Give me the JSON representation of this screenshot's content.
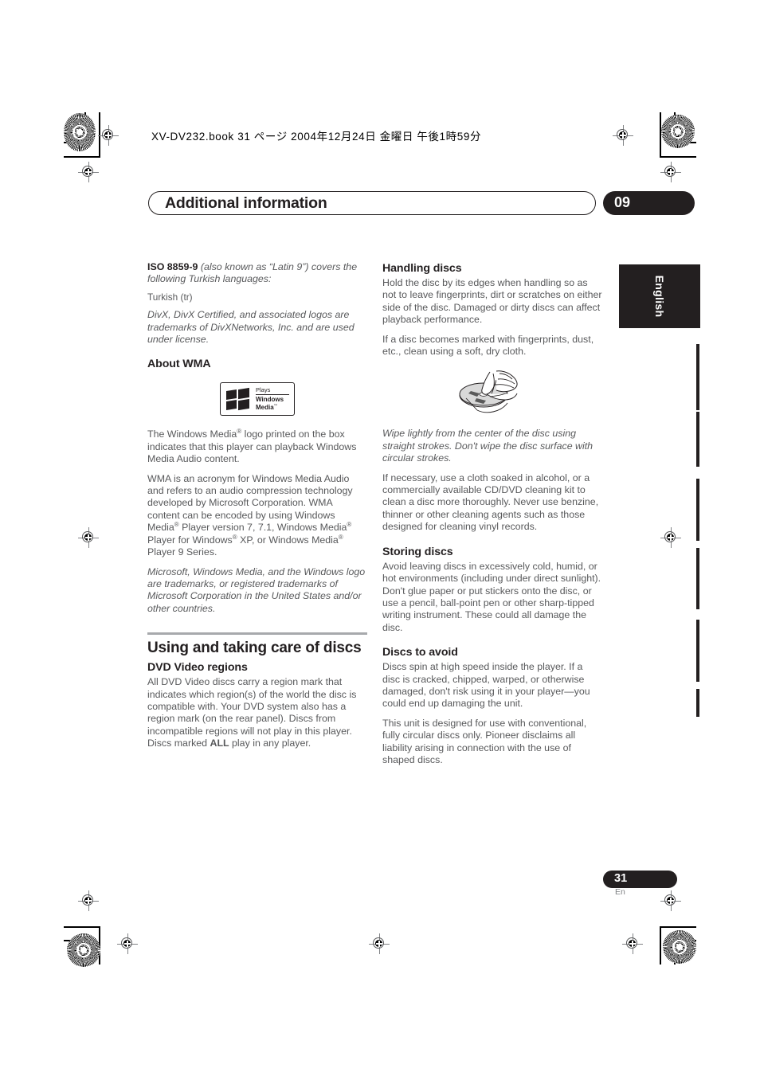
{
  "print_header": {
    "book_line": "XV-DV232.book 31 ページ 2004年12月24日 金曜日 午後1時59分"
  },
  "chapter": {
    "title": "Additional information",
    "number": "09"
  },
  "side_tab": {
    "label": "English"
  },
  "footer": {
    "page_number": "31",
    "language_code": "En"
  },
  "left_column": {
    "iso_paragraph_bold": "ISO 8859-9",
    "iso_paragraph_italic": " (also known as “Latin 9”) covers the following Turkish languages:",
    "turkish_line": "Turkish (tr)",
    "divx_paragraph": "DivX, DivX Certified, and associated logos are trademarks of DivXNetworks, Inc. and are used under license.",
    "about_wma_heading": "About WMA",
    "wma_logo": {
      "plays": "Plays",
      "windows": "Windows",
      "media": "Media",
      "media_tm": "™",
      "flag_tm": "™"
    },
    "wma_para_1_a": "The Windows Media",
    "wma_para_1_sup": "®",
    "wma_para_1_b": " logo printed on the box indicates that this player can playback Windows Media Audio content.",
    "wma_para_2_a": "WMA is an acronym for Windows Media Audio and refers to an audio compression technology developed by Microsoft Corporation. WMA content can be encoded by using Windows Media",
    "wma_para_2_b": " Player version 7, 7.1, Windows Media",
    "wma_para_2_c": " Player for Windows",
    "wma_para_2_d": " XP, or Windows Media",
    "wma_para_2_e": " Player 9 Series.",
    "wma_trademark_para": "Microsoft, Windows Media, and the Windows logo are trademarks, or registered trademarks of Microsoft Corporation in the United States and/or other countries.",
    "discs_section_heading": "Using and taking care of discs",
    "dvd_regions_heading": "DVD Video regions",
    "dvd_regions_para_a": "All DVD Video discs carry a region mark that indicates which region(s) of the world the disc is compatible with. Your DVD system also has a region mark (on the rear panel). Discs from incompatible regions will not play in this player. Discs marked ",
    "dvd_regions_all": "ALL",
    "dvd_regions_para_b": " play in any player."
  },
  "right_column": {
    "handling_heading": "Handling discs",
    "handling_para_1": "Hold the disc by its edges when handling so as not to leave fingerprints, dirt or scratches on either side of the disc. Damaged or dirty discs can affect playback performance.",
    "handling_para_2": "If a disc becomes marked with fingerprints, dust, etc., clean using a soft, dry cloth.",
    "wipe_caption": "Wipe lightly from the center of the disc using straight strokes. Don't wipe the disc surface with circular strokes.",
    "cleaning_para": "If necessary, use a cloth soaked in alcohol, or a commercially available CD/DVD cleaning kit to clean a disc more thoroughly. Never use benzine, thinner or other cleaning agents such as those designed for cleaning vinyl records.",
    "storing_heading": "Storing discs",
    "storing_para": "Avoid leaving discs in excessively cold, humid, or hot environments (including under direct sunlight). Don't glue paper or put stickers onto the disc, or use a pencil, ball-point pen or other sharp-tipped writing instrument. These could all damage the disc.",
    "avoid_heading": "Discs to avoid",
    "avoid_para_1": "Discs spin at high speed inside the player. If a disc is cracked, chipped, warped, or otherwise damaged, don't risk using it in your player—you could end up damaging the unit.",
    "avoid_para_2": "This unit is designed for use with conventional, fully circular discs only. Pioneer disclaims all liability arising in connection with the use of shaped discs."
  },
  "colors": {
    "ink_dark": "#231f20",
    "body_text": "#58595b",
    "rule_gray": "#a7a9ac"
  }
}
